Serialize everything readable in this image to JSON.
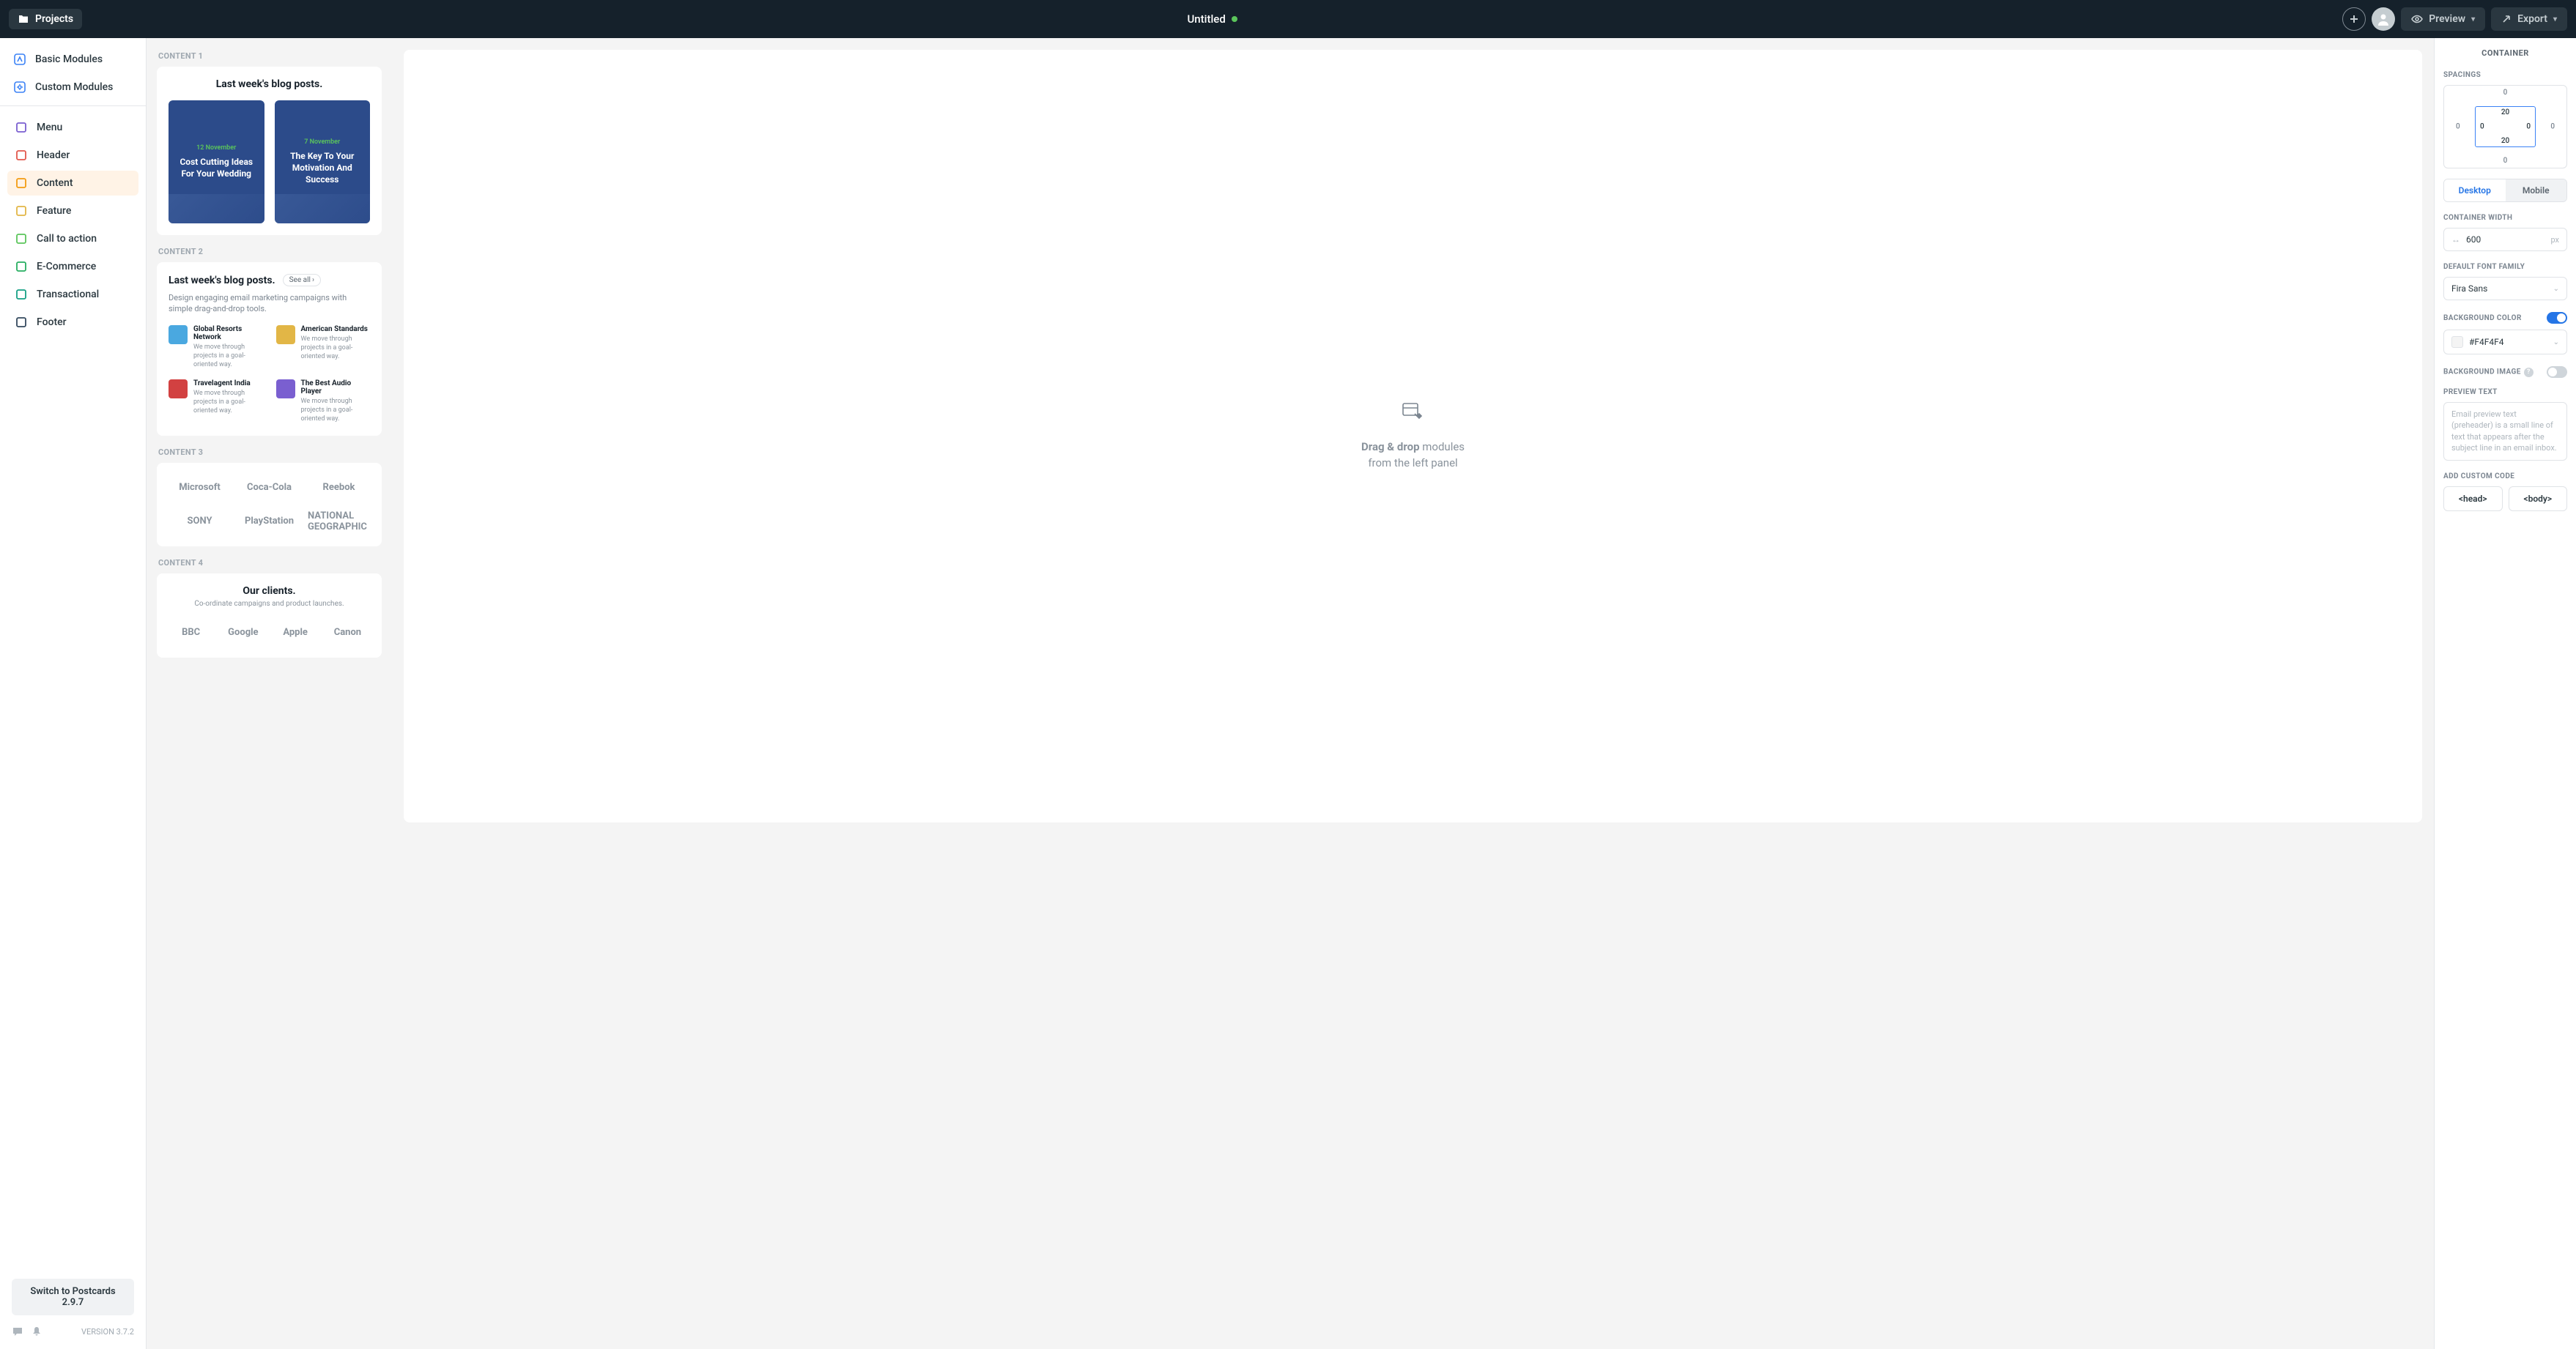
{
  "topbar": {
    "projects": "Projects",
    "title": "Untitled",
    "preview": "Preview",
    "export": "Export"
  },
  "sidebar": {
    "basic": "Basic Modules",
    "custom": "Custom Modules",
    "categories": [
      "Menu",
      "Header",
      "Content",
      "Feature",
      "Call to action",
      "E-Commerce",
      "Transactional",
      "Footer"
    ],
    "active_index": 2,
    "switch": "Switch to Postcards 2.9.7",
    "version": "VERSION 3.7.2"
  },
  "modules": {
    "c1": {
      "label": "CONTENT 1",
      "title": "Last week's blog posts.",
      "tiles": [
        {
          "date": "12 November",
          "title": "Cost Cutting Ideas For Your Wedding"
        },
        {
          "date": "7 November",
          "title": "The Key To Your Motivation And Success"
        }
      ]
    },
    "c2": {
      "label": "CONTENT 2",
      "title": "Last week's blog posts.",
      "see_all": "See all",
      "subtitle": "Design engaging email marketing campaigns with simple drag-and-drop tools.",
      "items": [
        {
          "title": "Global Resorts Network",
          "desc": "We move through projects in a goal-oriented way.",
          "color": "#4aa8e0"
        },
        {
          "title": "American Standards",
          "desc": "We move through projects in a goal-oriented way.",
          "color": "#e2b646"
        },
        {
          "title": "Travelagent India",
          "desc": "We move through projects in a goal-oriented way.",
          "color": "#d24141"
        },
        {
          "title": "The Best Audio Player",
          "desc": "We move through projects in a goal-oriented way.",
          "color": "#7a5fd0"
        }
      ]
    },
    "c3": {
      "label": "CONTENT 3",
      "logos": [
        "Microsoft",
        "Coca-Cola",
        "Reebok",
        "SONY",
        "PlayStation",
        "NATIONAL GEOGRAPHIC"
      ]
    },
    "c4": {
      "label": "CONTENT 4",
      "title": "Our clients.",
      "subtitle": "Co-ordinate campaigns and product launches.",
      "logos": [
        "BBC",
        "Google",
        "Apple",
        "Canon"
      ]
    }
  },
  "canvas": {
    "drop_strong": "Drag & drop",
    "drop_rest": "modules",
    "drop_line2": "from the left panel"
  },
  "rpanel": {
    "title": "CONTAINER",
    "spacings_label": "SPACINGS",
    "spacings": {
      "m_top": "0",
      "m_right": "0",
      "m_bottom": "0",
      "m_left": "0",
      "p_top": "20",
      "p_right": "0",
      "p_bottom": "20",
      "p_left": "0"
    },
    "desktop": "Desktop",
    "mobile": "Mobile",
    "width_label": "CONTAINER WIDTH",
    "width_value": "600",
    "width_unit": "px",
    "font_label": "DEFAULT FONT FAMILY",
    "font_value": "Fira Sans",
    "bgcolor_label": "BACKGROUND COLOR",
    "bgcolor_value": "#F4F4F4",
    "bgimage_label": "BACKGROUND IMAGE",
    "preview_label": "PREVIEW TEXT",
    "preview_placeholder": "Email preview text (preheader) is a small line of text that appears after the subject line in an email inbox.",
    "code_label": "ADD CUSTOM CODE",
    "code_head": "<head>",
    "code_body": "<body>"
  }
}
